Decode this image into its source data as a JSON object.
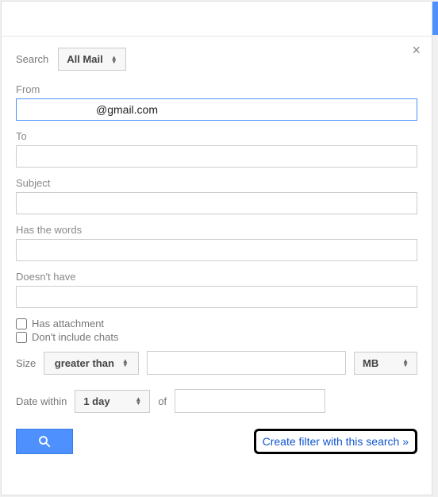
{
  "close_glyph": "×",
  "search": {
    "label": "Search",
    "scope": "All Mail"
  },
  "fields": {
    "from": {
      "label": "From",
      "value": "@gmail.com"
    },
    "to_label": "To",
    "subject_label": "Subject",
    "has_words_label": "Has the words",
    "doesnt_have_label": "Doesn't have"
  },
  "checks": {
    "attachment": "Has attachment",
    "no_chats": "Don't include chats"
  },
  "size": {
    "label": "Size",
    "comparator": "greater than",
    "unit": "MB"
  },
  "date": {
    "label": "Date within",
    "range": "1 day",
    "of": "of"
  },
  "actions": {
    "create_filter": "Create filter with this search »"
  }
}
